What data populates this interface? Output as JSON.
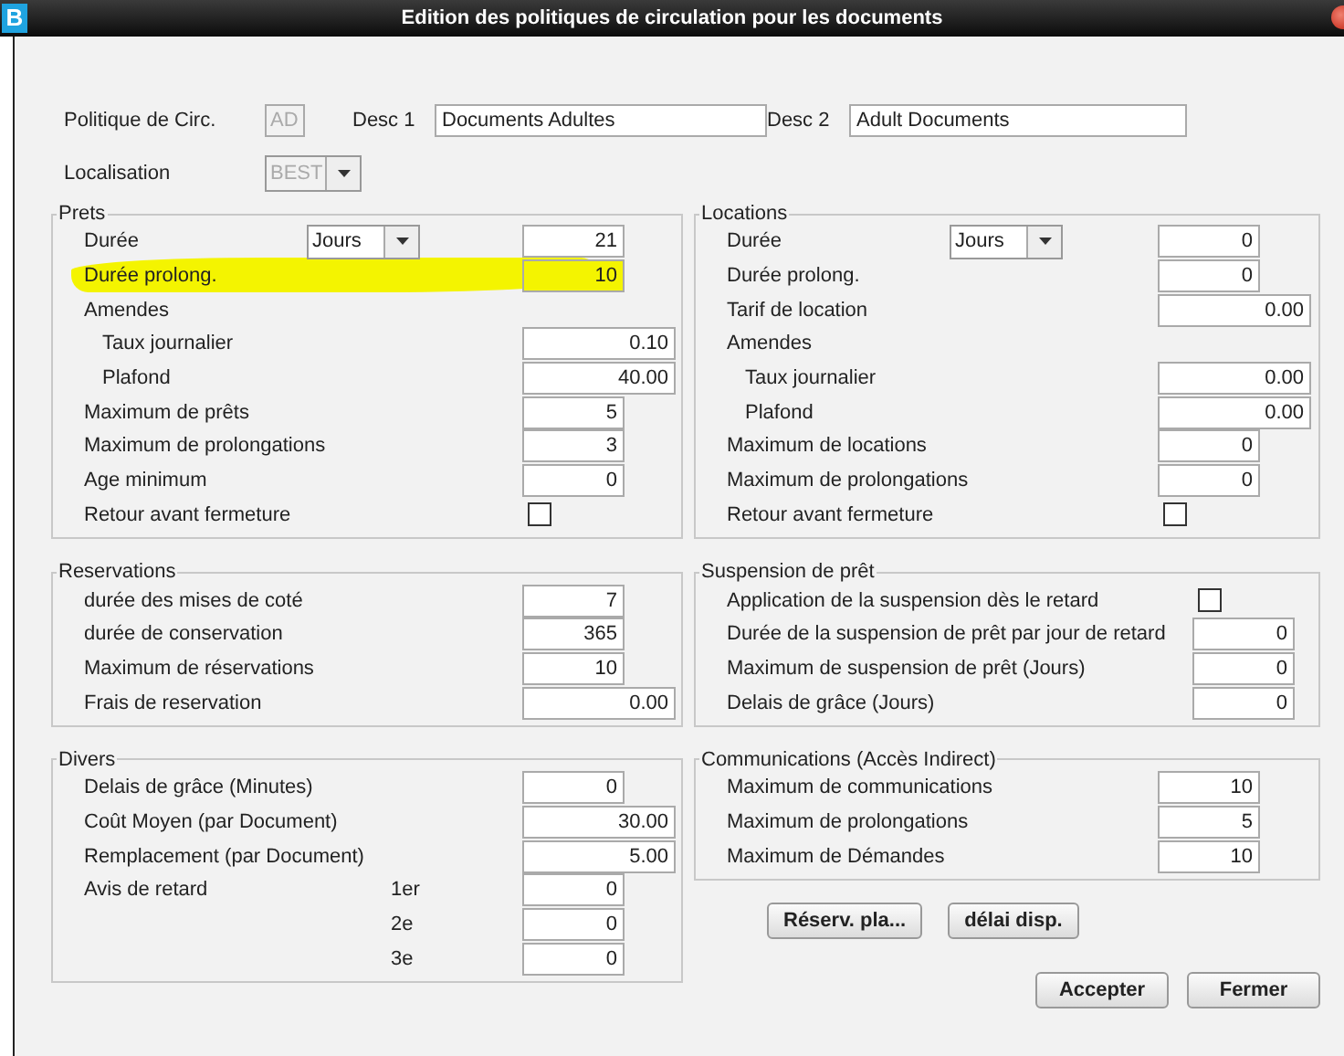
{
  "window": {
    "icon_text": "B",
    "title": "Edition des politiques de circulation pour les documents"
  },
  "header": {
    "policy_label": "Politique de Circ.",
    "policy_value": "AD",
    "policy_disabled": true,
    "desc1_label": "Desc 1",
    "desc1_value": "Documents Adultes",
    "desc2_label": "Desc 2",
    "desc2_value": "Adult Documents",
    "location_label": "Localisation",
    "location_value": "BEST",
    "location_disabled": true
  },
  "groups_left": [
    {
      "title": "Prets",
      "rows": [
        {
          "kind": "unit-count",
          "label": "Durée",
          "unit": "Jours",
          "value": "21"
        },
        {
          "kind": "count",
          "label": "Durée prolong.",
          "value": "10",
          "highlighted": true
        },
        {
          "kind": "heading",
          "label": "Amendes",
          "children": [
            {
              "kind": "amount",
              "label": "Taux journalier",
              "value": "0.10"
            },
            {
              "kind": "amount",
              "label": "Plafond",
              "value": "40.00"
            }
          ]
        },
        {
          "kind": "count",
          "label": "Maximum de prêts",
          "value": "5"
        },
        {
          "kind": "count",
          "label": "Maximum de prolongations",
          "value": "3"
        },
        {
          "kind": "count",
          "label": "Age minimum",
          "value": "0"
        },
        {
          "kind": "check",
          "label": "Retour avant fermeture",
          "checked": false
        }
      ]
    },
    {
      "title": "Reservations",
      "rows": [
        {
          "kind": "count",
          "label": "durée des mises de coté",
          "value": "7"
        },
        {
          "kind": "count",
          "label": "durée de conservation",
          "value": "365"
        },
        {
          "kind": "count",
          "label": "Maximum de réservations",
          "value": "10"
        },
        {
          "kind": "amount",
          "label": "Frais de reservation",
          "value": "0.00"
        }
      ]
    },
    {
      "title": "Divers",
      "rows": [
        {
          "kind": "count",
          "label": "Delais de grâce (Minutes)",
          "value": "0"
        },
        {
          "kind": "amount",
          "label": "Coût Moyen (par Document)",
          "value": "30.00"
        },
        {
          "kind": "amount",
          "label": "Remplacement (par Document)",
          "value": "5.00"
        },
        {
          "kind": "count",
          "label": "Avis de retard",
          "sublabel": "1er",
          "value": "0"
        },
        {
          "kind": "count",
          "sublabel": "2e",
          "value": "0"
        },
        {
          "kind": "count",
          "sublabel": "3e",
          "value": "0"
        }
      ]
    }
  ],
  "groups_right": [
    {
      "title": "Locations",
      "rows": [
        {
          "kind": "unit-count",
          "label": "Durée",
          "unit": "Jours",
          "value": "0"
        },
        {
          "kind": "count",
          "label": "Durée prolong.",
          "value": "0"
        },
        {
          "kind": "amount",
          "label": "Tarif de location",
          "value": "0.00"
        },
        {
          "kind": "heading",
          "label": "Amendes",
          "children": [
            {
              "kind": "amount",
              "label": "Taux journalier",
              "value": "0.00"
            },
            {
              "kind": "amount",
              "label": "Plafond",
              "value": "0.00"
            }
          ]
        },
        {
          "kind": "count",
          "label": "Maximum de locations",
          "value": "0"
        },
        {
          "kind": "count",
          "label": "Maximum de prolongations",
          "value": "0"
        },
        {
          "kind": "check",
          "label": "Retour avant fermeture",
          "checked": false
        }
      ]
    },
    {
      "title": "Suspension de prêt",
      "rows": [
        {
          "kind": "check",
          "label": "Application de la suspension dès le retard",
          "checked": false
        },
        {
          "kind": "count",
          "label": "Durée de la suspension de prêt par jour de retard",
          "value": "0"
        },
        {
          "kind": "count",
          "label": "Maximum de suspension de prêt (Jours)",
          "value": "0"
        },
        {
          "kind": "count",
          "label": "Delais de grâce (Jours)",
          "value": "0"
        }
      ]
    },
    {
      "title": "Communications (Accès Indirect)",
      "rows": [
        {
          "kind": "count",
          "label": "Maximum de communications",
          "value": "10"
        },
        {
          "kind": "count",
          "label": "Maximum de prolongations",
          "value": "5"
        },
        {
          "kind": "count",
          "label": "Maximum de Démandes",
          "value": "10"
        }
      ]
    }
  ],
  "side_buttons": [
    "Réserv. pla...",
    "délai disp."
  ],
  "buttons": [
    "Accepter",
    "Fermer"
  ]
}
